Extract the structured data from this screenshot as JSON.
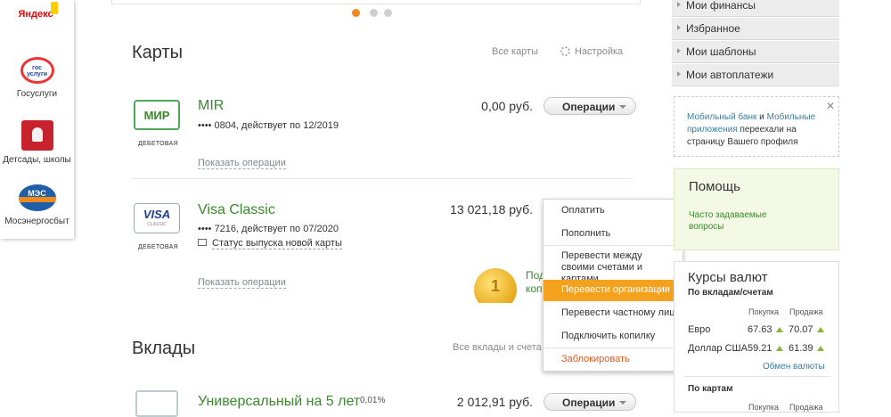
{
  "quick_links": {
    "yandex": "Яндекс",
    "gosuslugi_logo": "гос услуги",
    "gosuslugi": "Госуслуги",
    "detsady": "Детсады, школы",
    "mes_logo": "МЭС",
    "mosenergosbyt": "Мосэнергосбыт"
  },
  "carousel": {
    "active_index": 0,
    "count": 3
  },
  "cards": {
    "title": "Карты",
    "all_link": "Все карты",
    "settings_link": "Настройка",
    "items": [
      {
        "logo_text": "МИР",
        "type": "ДЕБЕТОВАЯ",
        "name": "MIR",
        "details": "•••• 0804, действует по 12/2019",
        "amount": "0,00 руб.",
        "button": "Операции",
        "show_ops": "Показать операции"
      },
      {
        "logo_text": "VISA",
        "logo_sub": "CLASSIC",
        "type": "ДЕБЕТОВАЯ",
        "name": "Visa Classic",
        "details": "•••• 7216, действует по 07/2020",
        "status": "Статус выпуска новой карты",
        "amount": "13 021,18 руб.",
        "button": "Операции",
        "show_ops": "Показать операции"
      }
    ]
  },
  "promo": {
    "badge": "1",
    "text_line1": "Под",
    "text_line2": "копи"
  },
  "operations_menu": {
    "items": [
      "Оплатить",
      "Пополнить",
      "Перевести между своими счетами и картами",
      "Перевести организации",
      "Перевести частному лицу",
      "Подключить копилку",
      "Заблокировать"
    ],
    "selected": "Перевести организации"
  },
  "deposits": {
    "title": "Вклады",
    "all_link": "Все вклады и счета",
    "items": [
      {
        "name": "Универсальный на 5 лет",
        "rate": "0,01%",
        "amount": "2 012,91 руб.",
        "button": "Операции"
      }
    ]
  },
  "right_nav": [
    "Мои финансы",
    "Избранное",
    "Мои шаблоны",
    "Мои автоплатежи"
  ],
  "mobile_notice": {
    "link1": "Мобильный банк",
    "and": " и ",
    "link2": "Мобильные приложения",
    "text": " переехали на страницу Вашего профиля"
  },
  "help": {
    "title": "Помощь",
    "faq": "Часто задаваемые вопросы"
  },
  "rates": {
    "title": "Курсы валют",
    "deposits_subtitle": "По вкладам/счетам",
    "buy_label": "Покупка",
    "sell_label": "Продажа",
    "rows": [
      {
        "currency": "Евро",
        "buy": "67.63",
        "sell": "70.07"
      },
      {
        "currency": "Доллар США",
        "buy": "59.21",
        "sell": "61.39"
      }
    ],
    "exchange_link": "Обмен валюты",
    "cards_subtitle": "По картам"
  },
  "colors": {
    "accent_orange": "#f4a21d",
    "link_green": "#3a8a2c",
    "help_bg": "#f3f9e4"
  }
}
